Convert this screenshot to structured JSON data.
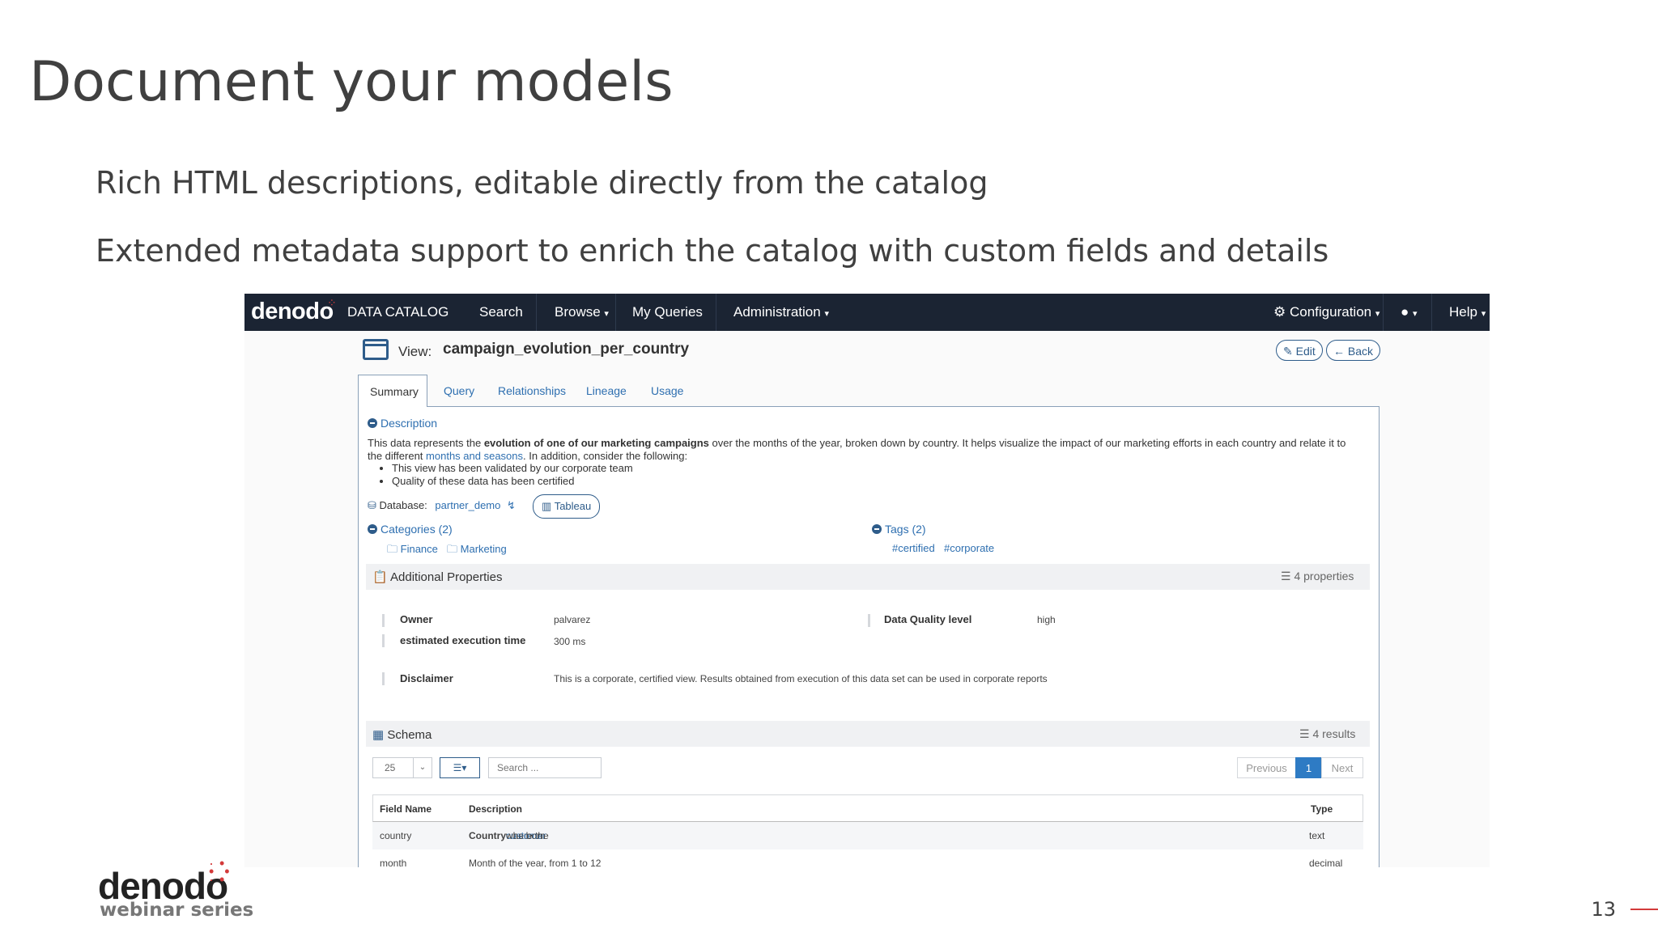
{
  "slide": {
    "title": "Document your models",
    "bullets": [
      "Rich HTML descriptions, editable directly from the catalog",
      "Extended metadata support to enrich the catalog with custom fields and details"
    ],
    "page_number": "13",
    "footer_logo": "denodo",
    "footer_sub": "webinar series"
  },
  "app": {
    "brand": "denodo",
    "product": "DATA CATALOG",
    "nav": {
      "search": "Search",
      "browse": "Browse",
      "my_queries": "My Queries",
      "administration": "Administration",
      "configuration": "Configuration",
      "help": "Help"
    },
    "view": {
      "label": "View:",
      "name": "campaign_evolution_per_country",
      "edit": "Edit",
      "back": "Back"
    },
    "tabs": [
      "Summary",
      "Query",
      "Relationships",
      "Lineage",
      "Usage"
    ],
    "description": {
      "header": "Description",
      "p1_start": "This data represents the ",
      "p1_bold": "evolution of one of our marketing campaigns",
      "p1_end": " over the months of the year, broken down by country. It helps visualize the impact of our marketing efforts in each country and relate it to the different ",
      "p1_link": "months and seasons",
      "p1_tail": ". In addition, consider the following:",
      "items": [
        "This view has been validated by our corporate team",
        "Quality of these data has been certified"
      ]
    },
    "database": {
      "label": "Database:",
      "value": "partner_demo",
      "tableau": "Tableau"
    },
    "categories": {
      "header": "Categories (2)",
      "items": [
        "Finance",
        "Marketing"
      ]
    },
    "tags": {
      "header": "Tags (2)",
      "items": [
        "#certified",
        "#corporate"
      ]
    },
    "additional": {
      "header": "Additional Properties",
      "count": "4 properties",
      "owner_k": "Owner",
      "owner_v": "palvarez",
      "quality_k": "Data Quality level",
      "quality_v": "high",
      "exec_k": "estimated execution time",
      "exec_v": "300 ms",
      "disclaimer_k": "Disclaimer",
      "disclaimer_v": "This is a corporate, certified view. Results obtained from execution of this data set can be used in corporate reports"
    },
    "schema": {
      "header": "Schema",
      "count": "4 results",
      "page_size": "25",
      "search_placeholder": "Search ...",
      "prev": "Previous",
      "page": "1",
      "next": "Next",
      "columns": [
        "Field Name",
        "Description",
        "Type"
      ],
      "rows": [
        {
          "field": "country",
          "desc_bold": "Country",
          "desc_mid": " where the ",
          "desc_link": "customer",
          "desc_end": " was born",
          "type": "text"
        },
        {
          "field": "month",
          "desc_plain": "Month of the year, from 1 to 12",
          "type": "decimal"
        }
      ]
    }
  },
  "colors": {
    "navbar": "#1b2433",
    "link": "#2e6fb0",
    "accent": "#d33a3a",
    "active_page": "#2e7bc4"
  }
}
